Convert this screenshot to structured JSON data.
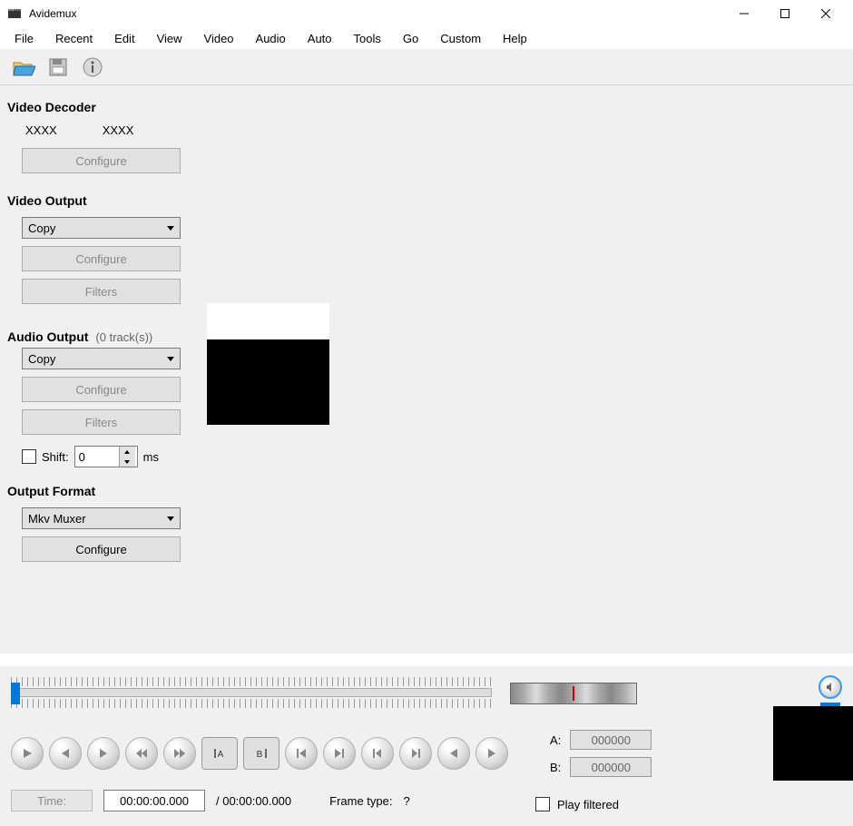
{
  "window": {
    "title": "Avidemux"
  },
  "menu": {
    "file": "File",
    "recent": "Recent",
    "edit": "Edit",
    "view": "View",
    "video": "Video",
    "audio": "Audio",
    "auto": "Auto",
    "tools": "Tools",
    "go": "Go",
    "custom": "Custom",
    "help": "Help"
  },
  "sidebar": {
    "video_decoder": {
      "title": "Video Decoder",
      "val1": "XXXX",
      "val2": "XXXX",
      "configure": "Configure"
    },
    "video_output": {
      "title": "Video Output",
      "select": "Copy",
      "configure": "Configure",
      "filters": "Filters"
    },
    "audio_output": {
      "title": "Audio Output",
      "tracks": "(0 track(s))",
      "select": "Copy",
      "configure": "Configure",
      "filters": "Filters",
      "shift_label": "Shift:",
      "shift_value": "0",
      "shift_unit": "ms"
    },
    "output_format": {
      "title": "Output Format",
      "select": "Mkv Muxer",
      "configure": "Configure"
    }
  },
  "bottom": {
    "a_label": "A:",
    "a_value": "000000",
    "b_label": "B:",
    "b_value": "000000",
    "play_filtered": "Play filtered",
    "time_label": "Time:",
    "time_current": "00:00:00.000",
    "time_total": "/ 00:00:00.000",
    "frame_type_label": "Frame type:",
    "frame_type_value": "?"
  }
}
